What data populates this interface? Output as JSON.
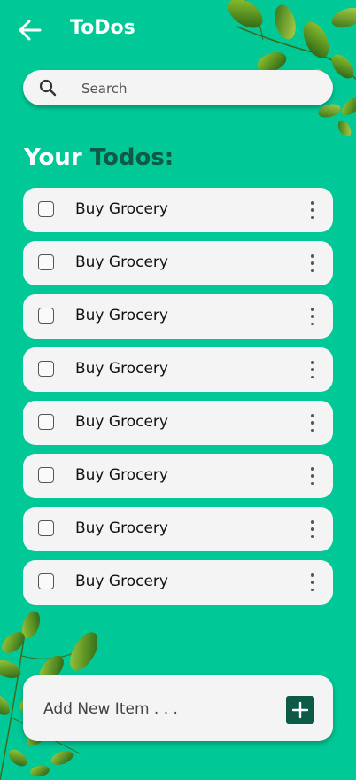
{
  "header": {
    "title": "ToDos",
    "back_icon": "arrow-left-icon"
  },
  "search": {
    "placeholder": "Search",
    "value": "",
    "icon": "search-icon"
  },
  "section": {
    "heading_part1": "Your",
    "heading_part2": "Todos:"
  },
  "todos": [
    {
      "label": "Buy Grocery",
      "checked": false
    },
    {
      "label": "Buy Grocery",
      "checked": false
    },
    {
      "label": "Buy Grocery",
      "checked": false
    },
    {
      "label": "Buy Grocery",
      "checked": false
    },
    {
      "label": "Buy Grocery",
      "checked": false
    },
    {
      "label": "Buy Grocery",
      "checked": false
    },
    {
      "label": "Buy Grocery",
      "checked": false
    },
    {
      "label": "Buy Grocery",
      "checked": false
    }
  ],
  "add_item": {
    "placeholder": "Add New Item . . .",
    "button_icon": "plus-icon"
  },
  "colors": {
    "background": "#00c896",
    "accent": "#0d5b46",
    "card": "#f4f4f4"
  }
}
